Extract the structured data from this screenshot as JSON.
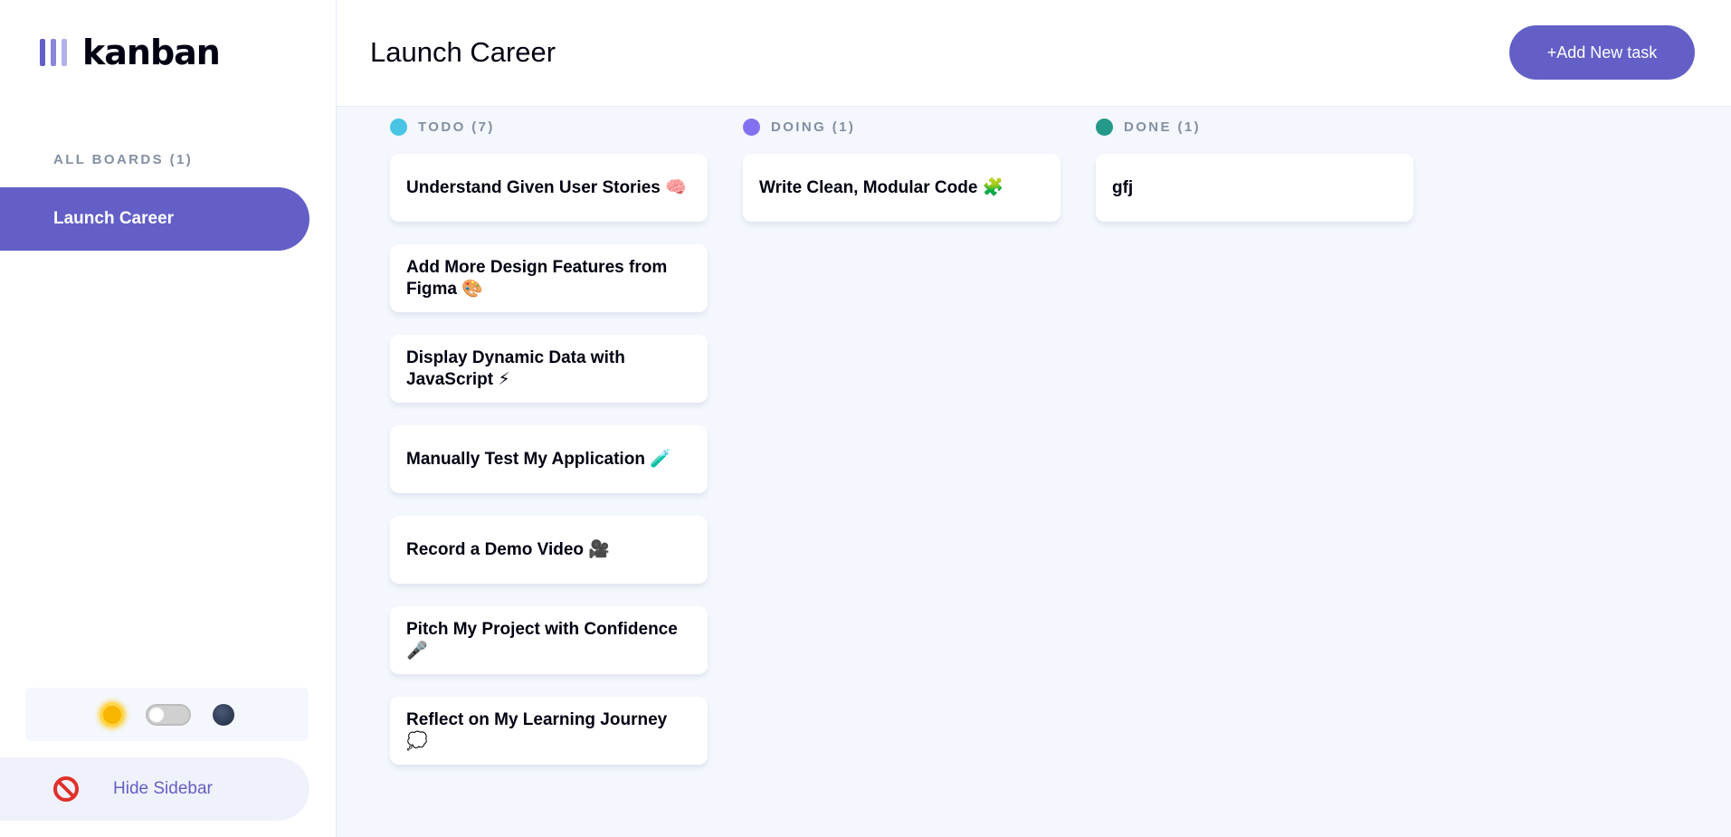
{
  "sidebar": {
    "logo_text": "kanban",
    "boards_heading": "ALL BOARDS (1)",
    "boards": [
      {
        "label": "Launch Career",
        "active": true
      }
    ],
    "hide_label": "Hide Sidebar",
    "theme": {
      "light_icon": "sun-icon",
      "dark_icon": "moon-icon",
      "dark_mode": false
    }
  },
  "header": {
    "title": "Launch Career",
    "add_task_label": "+Add New task"
  },
  "columns": [
    {
      "title": "TODO (7)",
      "color": "#49c4e5",
      "tasks": [
        "Understand Given User Stories 🧠",
        "Add More Design Features from Figma 🎨",
        "Display Dynamic Data with JavaScript ⚡",
        "Manually Test My Application 🧪",
        "Record a Demo Video 🎥",
        "Pitch My Project with Confidence 🎤",
        "Reflect on My Learning Journey 💭"
      ]
    },
    {
      "title": "DOING (1)",
      "color": "#8471f2",
      "tasks": [
        "Write Clean, Modular Code 🧩"
      ]
    },
    {
      "title": "DONE (1)",
      "color": "#24998a",
      "tasks": [
        "gfj"
      ]
    }
  ],
  "colors": {
    "accent": "#635fc7",
    "background": "#f4f7fd",
    "muted_text": "#828fa3",
    "logo_bars": [
      "#635fc7",
      "#8a86d8",
      "#b3b0ea"
    ]
  }
}
